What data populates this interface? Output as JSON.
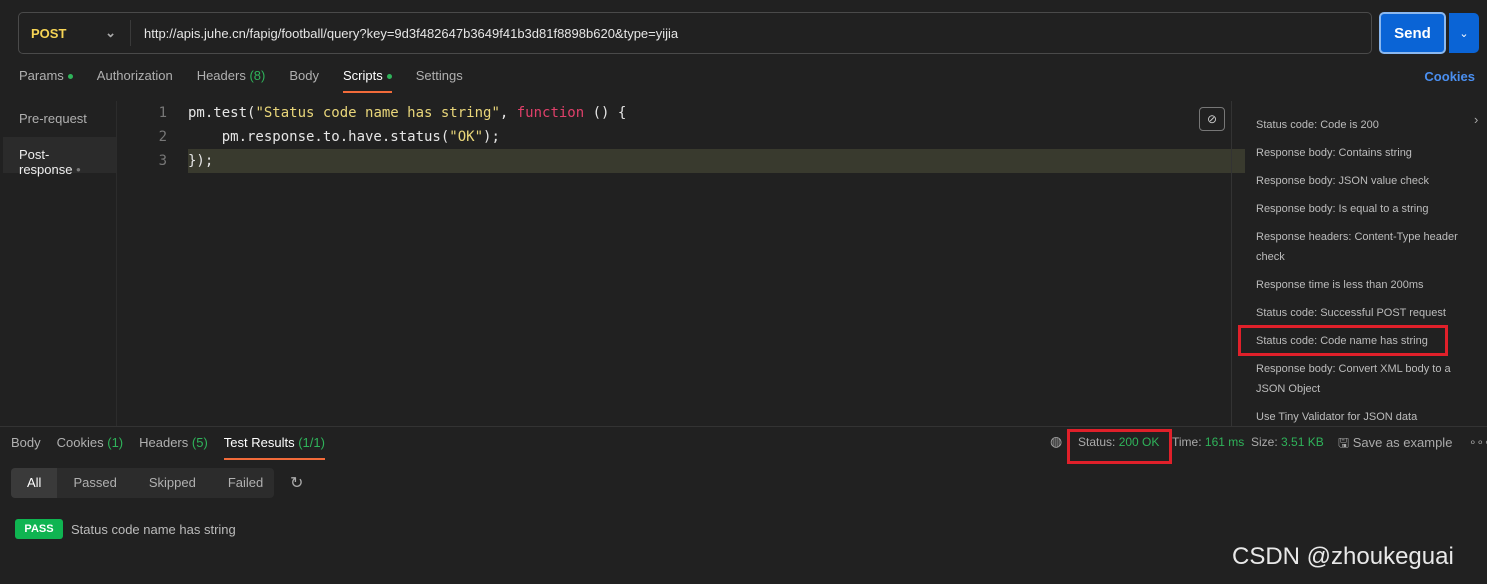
{
  "request": {
    "method": "POST",
    "url": "http://apis.juhe.cn/fapig/football/query?key=9d3f482647b3649f41b3d81f8898b620&type=yijia",
    "send": "Send"
  },
  "tabs": [
    {
      "label": "Params",
      "dot": true
    },
    {
      "label": "Authorization"
    },
    {
      "label": "Headers",
      "count": "(8)"
    },
    {
      "label": "Body"
    },
    {
      "label": "Scripts",
      "dot": true,
      "active": true
    },
    {
      "label": "Settings"
    }
  ],
  "cookies": "Cookies",
  "side": [
    "Pre-request",
    "Post-response"
  ],
  "code": {
    "l1a": "pm.test(",
    "l1b": "\"Status code name has string\"",
    "l1c": ", ",
    "l1d": "function",
    "l1e": " () {",
    "l2a": "    pm.response.to.have.status(",
    "l2b": "\"OK\"",
    "l2c": ");",
    "l3": "});"
  },
  "snippets": [
    "Status code: Code is 200",
    "Response body: Contains string",
    "Response body: JSON value check",
    "Response body: Is equal to a string",
    "Response headers: Content-Type header check",
    "Response time is less than 200ms",
    "Status code: Successful POST request",
    "Status code: Code name has string",
    "Response body: Convert XML body to a JSON Object",
    "Use Tiny Validator for JSON data"
  ],
  "response": {
    "tabs": [
      {
        "label": "Body"
      },
      {
        "label": "Cookies",
        "count": "(1)"
      },
      {
        "label": "Headers",
        "count": "(5)"
      },
      {
        "label": "Test Results",
        "count": "(1/1)"
      }
    ],
    "status_label": "Status:",
    "status": "200 OK",
    "time_label": "Time:",
    "time": "161 ms",
    "size_label": "Size:",
    "size": "3.51 KB",
    "save": "Save as example",
    "filters": [
      "All",
      "Passed",
      "Skipped",
      "Failed"
    ],
    "result_badge": "PASS",
    "result_name": "Status code name has string"
  },
  "watermark": "CSDN @zhoukeguai"
}
